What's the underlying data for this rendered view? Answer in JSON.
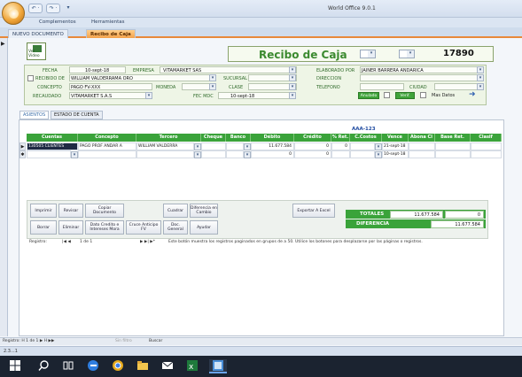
{
  "app": {
    "title": "World Office 9.0.1",
    "qa_undo": "↶ ·",
    "qa_redo": "↷ ·",
    "qa_more": "▾"
  },
  "ribbon_tabs": [
    "Complementos",
    "Herramientas"
  ],
  "doc_tabs": [
    {
      "label": "NUEVO DOCUMENTO",
      "active": false
    },
    {
      "label": "Recibo de Caja",
      "active": true
    }
  ],
  "header": {
    "var_video": "Ver Video",
    "doc_title": "Recibo de Caja",
    "number": "17890"
  },
  "form": {
    "fecha_label": "FECHA",
    "fecha_value": "10-sept-18",
    "empresa_label": "EMPRESA",
    "empresa_value": "VITAMARKET SAS",
    "elaborado_label": "ELABORADO POR",
    "elaborado_value": "JAINER BARRERA ANDARICA",
    "recibido_label": "RECIBIDO DE",
    "recibido_value": "WILLIAM VALDERRAMA ORO",
    "sucursal_label": "SUCURSAL",
    "direccion_label": "DIRECCION",
    "concepto_label": "CONCEPTO",
    "concepto_value": "PAGO FV-XXX",
    "moneda_label": "MONEDA",
    "clase_label": "CLASE",
    "telefono_label": "TELEFONO",
    "ciudad_label": "CIUDAD",
    "recaudado_label": "RECAUDADO",
    "recaudado_value": "VITAMARKET S.A.S",
    "fecmdc_label": "FEC MDC",
    "fecmdc_value": "10-sept-18",
    "anulado_label": "Anulado",
    "verif_label": "Verif.",
    "mas_datos_label": "Mas Datos"
  },
  "subtabs": [
    "ASIENTOS",
    "ESTADO DE CUENTA"
  ],
  "grid": {
    "caption": "AAA-123",
    "columns": [
      "Cuentas",
      "Concepto",
      "Tercero",
      "Cheque",
      "Banco",
      "Débito",
      "Crédito",
      "% Ret.",
      "C.Costos",
      "Vence",
      "Abona CI",
      "Base Ret.",
      "Clasif"
    ],
    "rows": [
      {
        "marker": "▶",
        "cuenta": "130505 CLIENTES",
        "concepto": "PAGO PROF ANDAR A",
        "tercero": "WILLIAM VALDERRA",
        "debito": "11.677.584",
        "credito": "0",
        "ret": "0",
        "vence": "21-sept-18"
      },
      {
        "marker": "✱",
        "cuenta": "",
        "concepto": "",
        "tercero": "",
        "debito": "0",
        "credito": "0",
        "ret": "",
        "vence": "10-sept-18"
      }
    ]
  },
  "actions": {
    "imprimir": "Imprimir",
    "revisar": "Revisar",
    "copiar": "Copiar Documento",
    "cuadrar": "Cuadrar",
    "diferencia": "Diferencia en Cambio",
    "exportar": "Exportar A Excel",
    "borrar": "Borrar",
    "eliminar": "Eliminar",
    "datos_credito": "Dato Credito e Intereses Mora",
    "cruce": "Cruce Anticipo FV",
    "doc_general": "Doc. General",
    "ayudar": "Ayudar"
  },
  "totals": {
    "totales_label": "TOTALES",
    "totales_debit": "11.677.584",
    "totales_credit": "0",
    "diferencia_label": "DIFERENCIA",
    "diferencia_value": "11.677.584"
  },
  "nav": {
    "registro_label": "Registro:",
    "registro_value": "1 de 1",
    "hint": "Este botón muestra los registros paginados en grupos de a 50. Utilice los botones para desplazarse por las páginas o registros.",
    "bottom_registro": "Registro: H  1 de 1  ▶ H ▶▶",
    "sin_filtro": "Sin filtro",
    "buscar": "Buscar"
  },
  "status": {
    "left": "2.3...1"
  }
}
